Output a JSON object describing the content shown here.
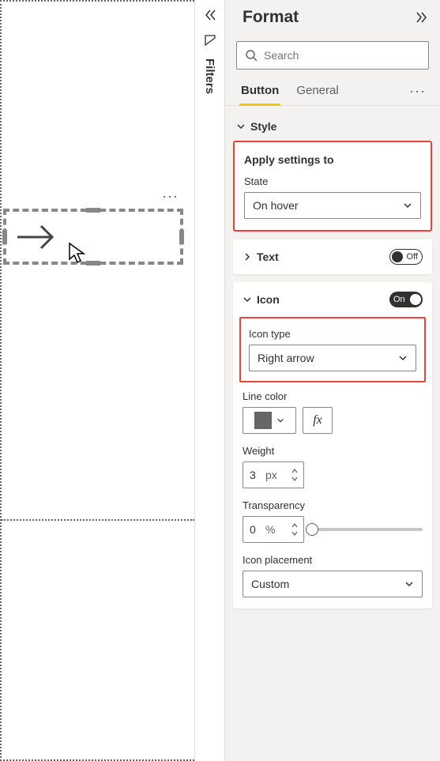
{
  "filters": {
    "label": "Filters"
  },
  "pane": {
    "title": "Format",
    "search_placeholder": "Search",
    "tabs": {
      "button": "Button",
      "general": "General"
    }
  },
  "style": {
    "title": "Style",
    "apply_label": "Apply settings to",
    "state_label": "State",
    "state_value": "On hover"
  },
  "text": {
    "title": "Text",
    "toggle": "Off"
  },
  "icon": {
    "title": "Icon",
    "toggle": "On",
    "type_label": "Icon type",
    "type_value": "Right arrow",
    "line_color_label": "Line color",
    "line_color": "#666666",
    "weight_label": "Weight",
    "weight_value": "3",
    "weight_unit": "px",
    "transparency_label": "Transparency",
    "transparency_value": "0",
    "transparency_unit": "%",
    "placement_label": "Icon placement",
    "placement_value": "Custom",
    "fx": "fx"
  }
}
